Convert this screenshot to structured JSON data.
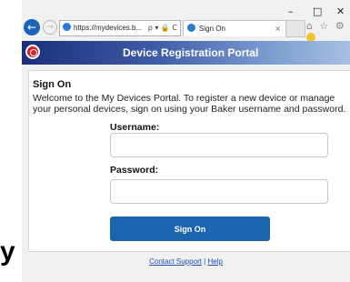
{
  "browser": {
    "url": "https://mydevices.b...",
    "tab_title": "Sign On",
    "window_min": "–",
    "window_max": "□",
    "window_close": "✕",
    "address_tools": "ρ ▾ 🔒 C",
    "tab_close": "×",
    "toolbar_icons": "⌂ ☆ ⚙"
  },
  "banner": {
    "title": "Device Registration Portal"
  },
  "form": {
    "heading": "Sign On",
    "welcome_text": "Welcome to the My Devices Portal. To register a new device or manage your personal devices, sign on using your Baker username and password.",
    "username_label": "Username:",
    "username_value": "",
    "password_label": "Password:",
    "password_value": "",
    "submit_label": "Sign On"
  },
  "footer": {
    "contact_label": "Contact Support",
    "separator": " | ",
    "help_label": "Help"
  },
  "left_mark": "y",
  "colors": {
    "banner_start": "#1a2f79",
    "banner_end": "#a8bfe3",
    "button": "#1d64ae",
    "link": "#1d4fb0",
    "logo": "#d8202a"
  }
}
